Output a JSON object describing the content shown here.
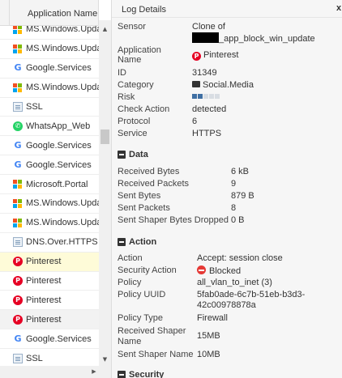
{
  "app_list": {
    "header": "Application Name",
    "rows": [
      {
        "label": "MS.Windows.Update",
        "icon": "windows-icon"
      },
      {
        "label": "MS.Windows.Update",
        "icon": "windows-icon"
      },
      {
        "label": "Google.Services",
        "icon": "google-icon"
      },
      {
        "label": "MS.Windows.Update",
        "icon": "windows-icon"
      },
      {
        "label": "SSL",
        "icon": "document-icon"
      },
      {
        "label": "WhatsApp_Web",
        "icon": "whatsapp-icon"
      },
      {
        "label": "Google.Services",
        "icon": "google-icon"
      },
      {
        "label": "Google.Services",
        "icon": "google-icon"
      },
      {
        "label": "Microsoft.Portal",
        "icon": "windows-icon"
      },
      {
        "label": "MS.Windows.Update",
        "icon": "windows-icon"
      },
      {
        "label": "MS.Windows.Update",
        "icon": "windows-icon"
      },
      {
        "label": "DNS.Over.HTTPS",
        "icon": "document-icon"
      },
      {
        "label": "Pinterest",
        "icon": "pinterest-icon"
      },
      {
        "label": "Pinterest",
        "icon": "pinterest-icon"
      },
      {
        "label": "Pinterest",
        "icon": "pinterest-icon"
      },
      {
        "label": "Pinterest",
        "icon": "pinterest-icon"
      },
      {
        "label": "Google.Services",
        "icon": "google-icon"
      },
      {
        "label": "SSL",
        "icon": "document-icon"
      }
    ]
  },
  "panel": {
    "title": "Log Details",
    "close": "x",
    "sensor": {
      "label": "Sensor",
      "line1": "Clone of",
      "line2_suffix": "_app_block_win_update"
    },
    "application": {
      "label_line1": "Application",
      "label_line2": "Name",
      "value": "Pinterest"
    },
    "id": {
      "label": "ID",
      "value": "31349"
    },
    "category": {
      "label": "Category",
      "value": "Social.Media"
    },
    "risk": {
      "label": "Risk",
      "level": 2,
      "max": 5
    },
    "check_action": {
      "label": "Check Action",
      "value": "detected"
    },
    "protocol": {
      "label": "Protocol",
      "value": "6"
    },
    "service": {
      "label": "Service",
      "value": "HTTPS"
    },
    "data_section": {
      "title": "Data",
      "rows": [
        {
          "label": "Received Bytes",
          "value": "6 kB"
        },
        {
          "label": "Received Packets",
          "value": "9"
        },
        {
          "label": "Sent Bytes",
          "value": "879 B"
        },
        {
          "label": "Sent Packets",
          "value": "8"
        },
        {
          "label": "Sent Shaper Bytes Dropped",
          "value": "0 B"
        }
      ]
    },
    "action_section": {
      "title": "Action",
      "action": {
        "label": "Action",
        "value": "Accept: session close"
      },
      "security_action": {
        "label": "Security Action",
        "value": "Blocked"
      },
      "policy": {
        "label": "Policy",
        "value": "all_vlan_to_inet (3)"
      },
      "policy_uuid": {
        "label": "Policy UUID",
        "line1": "5fab0ade-6c7b-51eb-b3d3-",
        "line2": "42c00978878a"
      },
      "policy_type": {
        "label": "Policy Type",
        "value": "Firewall"
      },
      "received_shaper": {
        "label_line1": "Received Shaper",
        "label_line2": "Name",
        "value": "15MB"
      },
      "sent_shaper": {
        "label": "Sent Shaper Name",
        "value": "10MB"
      }
    },
    "security_section": {
      "title": "Security"
    }
  },
  "colors": {
    "highlight_row": "#fefbd8",
    "pinterest": "#e60023",
    "blocked": "#e53935",
    "risk_on": "#3f6fa3"
  }
}
